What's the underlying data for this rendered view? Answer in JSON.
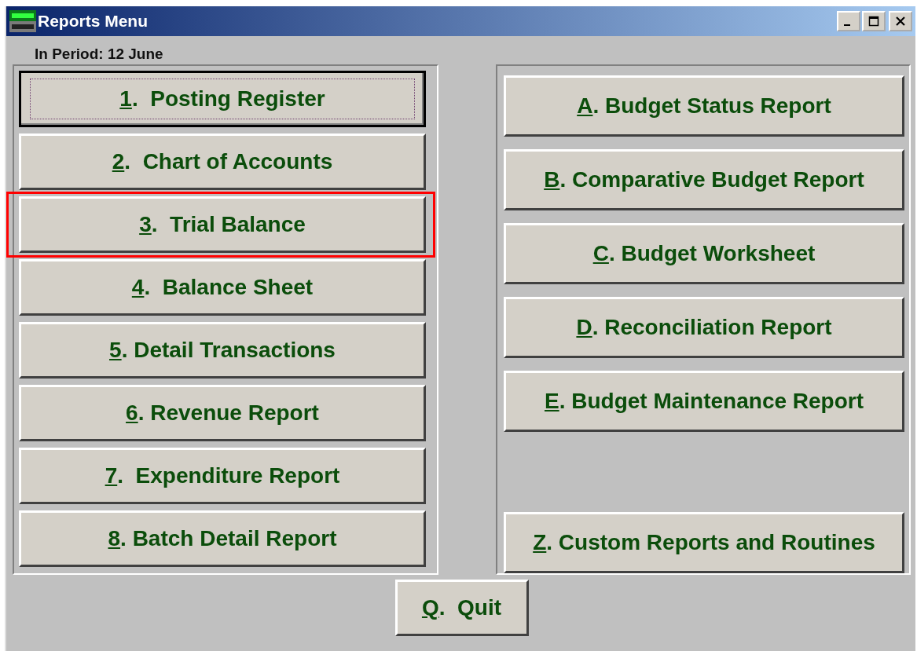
{
  "window": {
    "title": "Reports Menu"
  },
  "period": "In Period: 12 June",
  "left_buttons": [
    {
      "key": "1",
      "label": ".  Posting Register",
      "focused": true,
      "highlighted": false
    },
    {
      "key": "2",
      "label": ".  Chart of Accounts",
      "focused": false,
      "highlighted": false
    },
    {
      "key": "3",
      "label": ".  Trial Balance",
      "focused": false,
      "highlighted": true
    },
    {
      "key": "4",
      "label": ".  Balance Sheet",
      "focused": false,
      "highlighted": false
    },
    {
      "key": "5",
      "label": ". Detail Transactions",
      "focused": false,
      "highlighted": false
    },
    {
      "key": "6",
      "label": ". Revenue Report",
      "focused": false,
      "highlighted": false
    },
    {
      "key": "7",
      "label": ".  Expenditure Report",
      "focused": false,
      "highlighted": false
    },
    {
      "key": "8",
      "label": ". Batch Detail Report",
      "focused": false,
      "highlighted": false
    }
  ],
  "right_buttons": [
    {
      "key": "A",
      "label": ". Budget Status Report"
    },
    {
      "key": "B",
      "label": ". Comparative Budget Report"
    },
    {
      "key": "C",
      "label": ". Budget Worksheet"
    },
    {
      "key": "D",
      "label": ". Reconciliation Report"
    },
    {
      "key": "E",
      "label": ". Budget Maintenance Report"
    }
  ],
  "custom_button": {
    "key": "Z",
    "label": ". Custom Reports and Routines"
  },
  "quit_button": {
    "key": "Q",
    "label": ".  Quit"
  }
}
